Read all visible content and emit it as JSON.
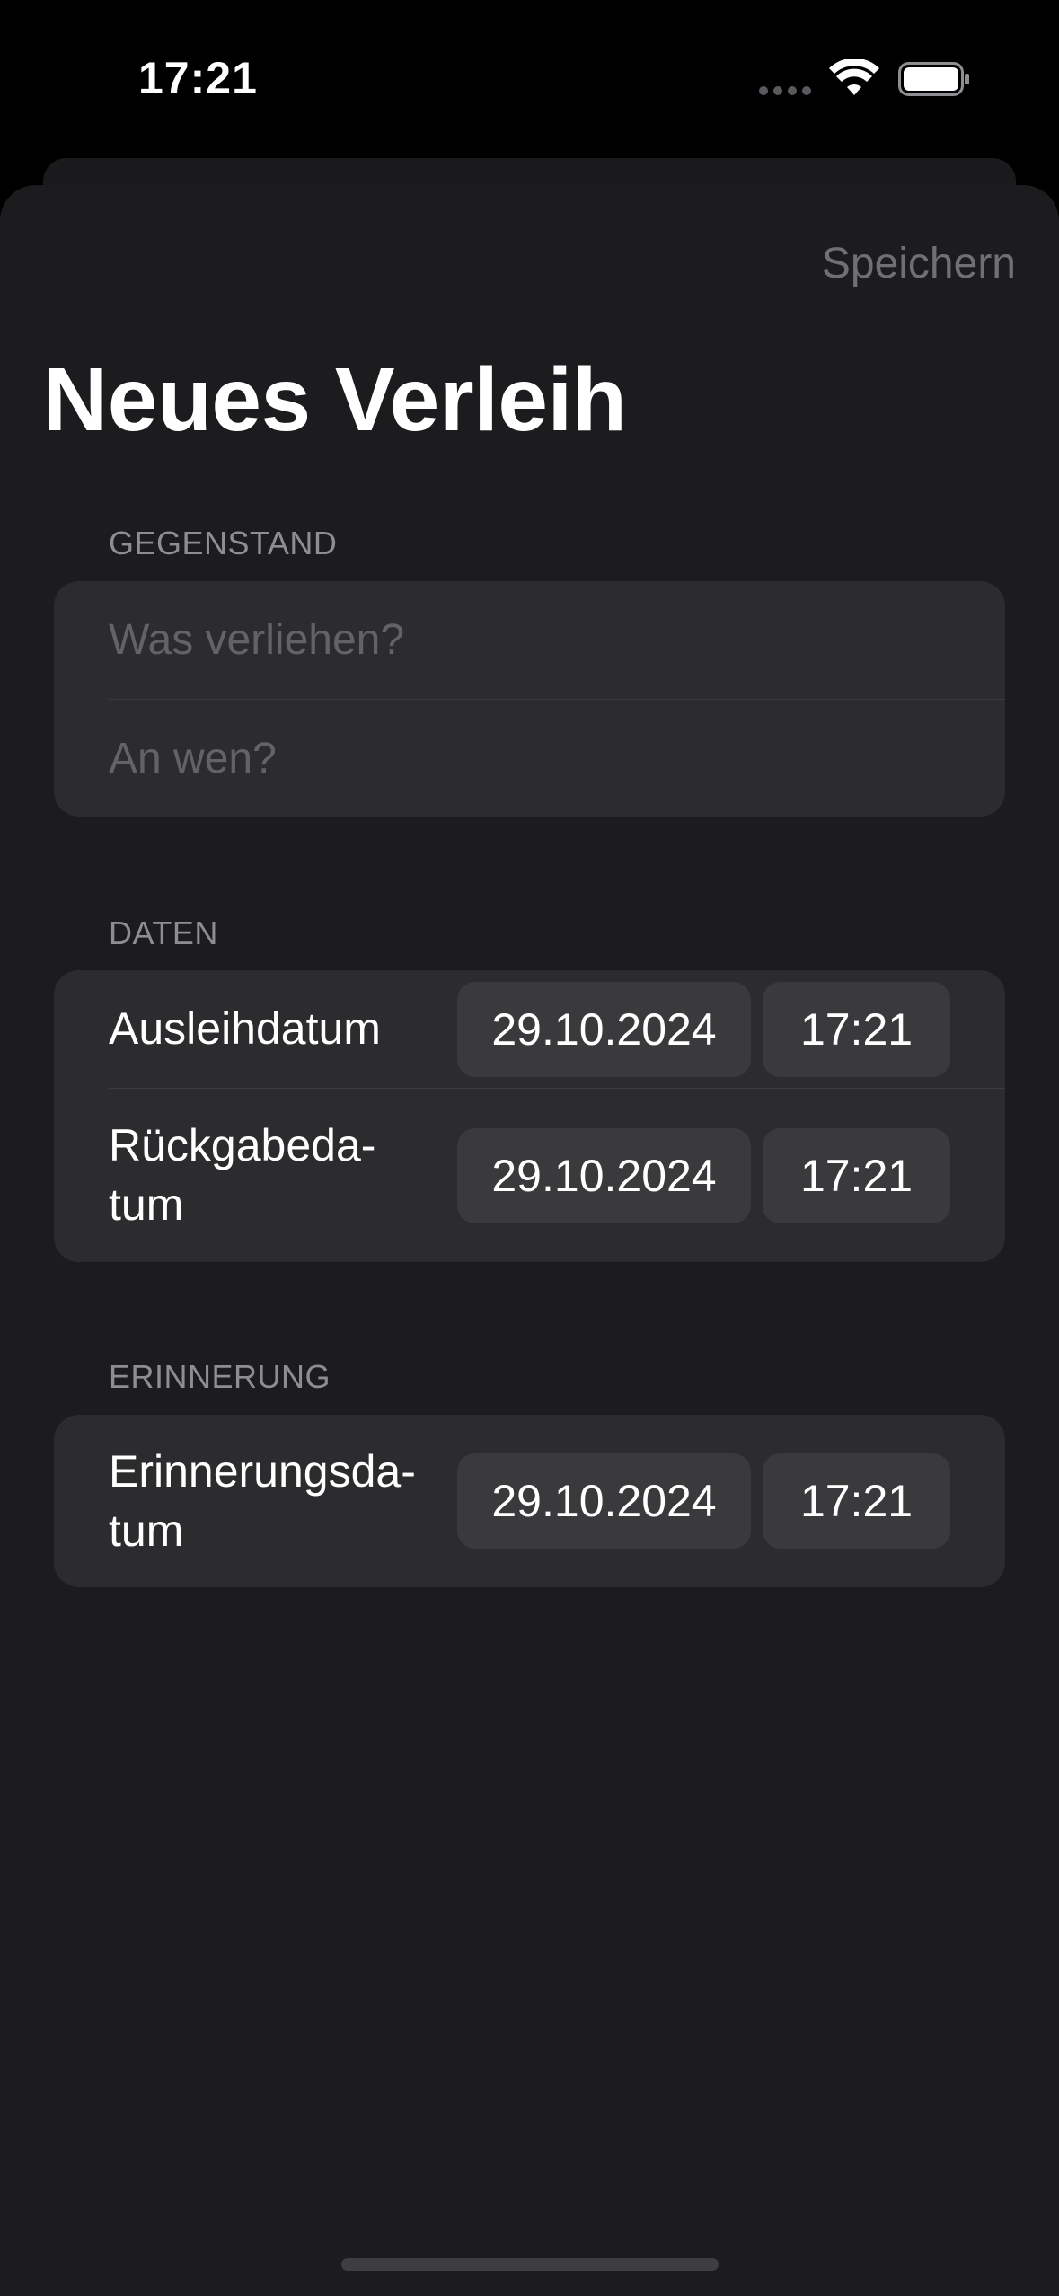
{
  "status_bar": {
    "time": "17:21"
  },
  "nav": {
    "save_label": "Speichern"
  },
  "title": "Neues Verleih",
  "sections": {
    "item": {
      "header": "GEGENSTAND",
      "what_placeholder": "Was verliehen?",
      "what_value": "",
      "whom_placeholder": "An wen?",
      "whom_value": ""
    },
    "dates": {
      "header": "DATEN",
      "loan": {
        "label": "Ausleihdatum",
        "date": "29.10.2024",
        "time": "17:21"
      },
      "return": {
        "label_line1": "Rückgabeda-",
        "label_line2": "tum",
        "date": "29.10.2024",
        "time": "17:21"
      }
    },
    "reminder": {
      "header": "ERINNERUNG",
      "reminder": {
        "label_line1": "Erinnerungsda-",
        "label_line2": "tum",
        "date": "29.10.2024",
        "time": "17:21"
      }
    }
  },
  "colors": {
    "background": "#000000",
    "sheet": "#1c1c1e",
    "group": "#2c2c2e",
    "pill": "#3a3a3c",
    "secondary_text": "#8d8d93",
    "placeholder_text": "#636366",
    "disabled_button": "#6f6f74"
  },
  "icons": {
    "wifi": "wifi-icon",
    "battery": "battery-icon",
    "signal": "cellular-signal-icon"
  }
}
